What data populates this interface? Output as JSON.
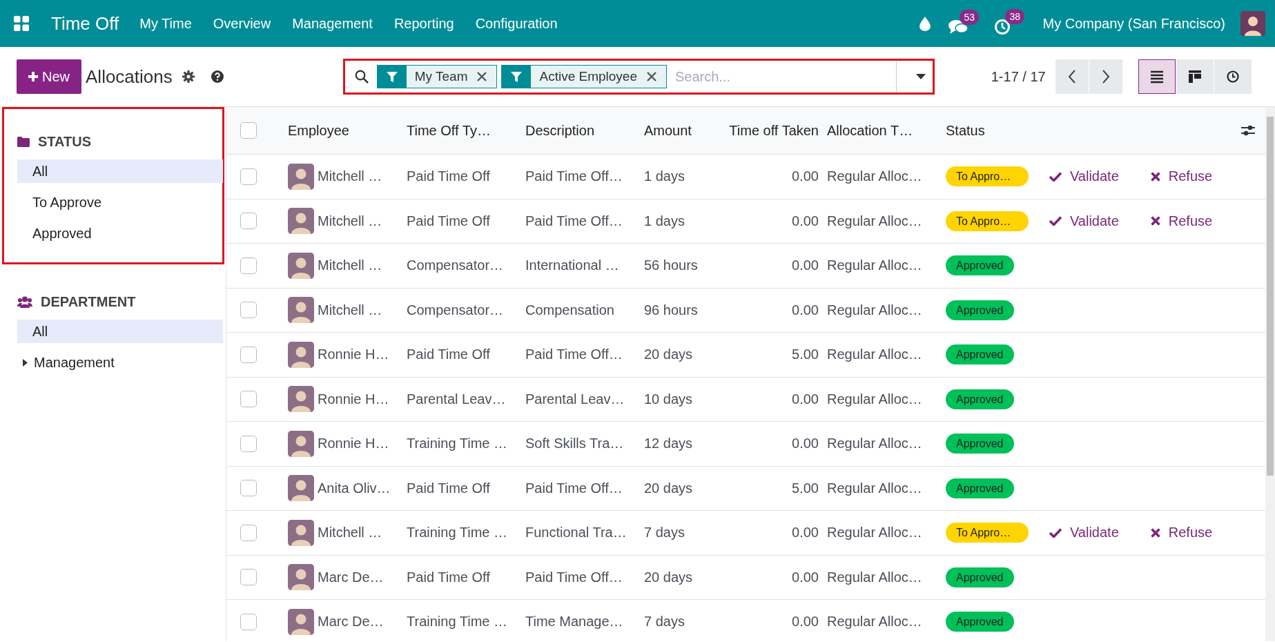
{
  "navbar": {
    "app_name": "Time Off",
    "menu": [
      "My Time",
      "Overview",
      "Management",
      "Reporting",
      "Configuration"
    ],
    "messages_count": "53",
    "activities_count": "38",
    "company": "My Company (San Francisco)"
  },
  "control_panel": {
    "new_button": "New",
    "title": "Allocations",
    "search": {
      "highlighted": true,
      "facets": [
        {
          "label": "My Team"
        },
        {
          "label": "Active Employee"
        }
      ],
      "placeholder": "Search..."
    },
    "pager": "1-17 / 17",
    "views": [
      {
        "kind": "list",
        "selected": true
      },
      {
        "kind": "kanban",
        "selected": false
      },
      {
        "kind": "activity",
        "selected": false
      }
    ]
  },
  "sidebar": {
    "sections": [
      {
        "kind": "status",
        "title": "STATUS",
        "highlighted": true,
        "items": [
          {
            "label": "All",
            "selected": true
          },
          {
            "label": "To Approve",
            "selected": false
          },
          {
            "label": "Approved",
            "selected": false
          }
        ]
      },
      {
        "kind": "department",
        "title": "DEPARTMENT",
        "highlighted": false,
        "items": [
          {
            "label": "All",
            "selected": true
          },
          {
            "label": "Management",
            "selected": false,
            "expanded": false
          }
        ]
      }
    ]
  },
  "table": {
    "select_all_checked": false,
    "columns": [
      "Employee",
      "Time Off Ty…",
      "Description",
      "Amount",
      "Time off Taken",
      "Allocation T…",
      "Status"
    ],
    "rows": [
      {
        "checked": false,
        "employee": "Mitchell …",
        "type": "Paid Time Off",
        "description": "Paid Time Off…",
        "amount": "1 days",
        "taken": "0.00",
        "allocation_type": "Regular Alloc…",
        "status": {
          "kind": "to_approve",
          "label": "To Appro…"
        },
        "actions": [
          {
            "kind": "validate",
            "label": "Validate"
          },
          {
            "kind": "refuse",
            "label": "Refuse"
          }
        ]
      },
      {
        "checked": false,
        "employee": "Mitchell …",
        "type": "Paid Time Off",
        "description": "Paid Time Off…",
        "amount": "1 days",
        "taken": "0.00",
        "allocation_type": "Regular Alloc…",
        "status": {
          "kind": "to_approve",
          "label": "To Appro…"
        },
        "actions": [
          {
            "kind": "validate",
            "label": "Validate"
          },
          {
            "kind": "refuse",
            "label": "Refuse"
          }
        ]
      },
      {
        "checked": false,
        "employee": "Mitchell …",
        "type": "Compensator…",
        "description": "International …",
        "amount": "56 hours",
        "taken": "0.00",
        "allocation_type": "Regular Alloc…",
        "status": {
          "kind": "approved",
          "label": "Approved"
        }
      },
      {
        "checked": false,
        "employee": "Mitchell …",
        "type": "Compensator…",
        "description": "Compensation",
        "amount": "96 hours",
        "taken": "0.00",
        "allocation_type": "Regular Alloc…",
        "status": {
          "kind": "approved",
          "label": "Approved"
        }
      },
      {
        "checked": false,
        "employee": "Ronnie H…",
        "type": "Paid Time Off",
        "description": "Paid Time Off…",
        "amount": "20 days",
        "taken": "5.00",
        "allocation_type": "Regular Alloc…",
        "status": {
          "kind": "approved",
          "label": "Approved"
        }
      },
      {
        "checked": false,
        "employee": "Ronnie H…",
        "type": "Parental Leav…",
        "description": "Parental Leav…",
        "amount": "10 days",
        "taken": "0.00",
        "allocation_type": "Regular Alloc…",
        "status": {
          "kind": "approved",
          "label": "Approved"
        }
      },
      {
        "checked": false,
        "employee": "Ronnie H…",
        "type": "Training Time …",
        "description": "Soft Skills Tra…",
        "amount": "12 days",
        "taken": "0.00",
        "allocation_type": "Regular Alloc…",
        "status": {
          "kind": "approved",
          "label": "Approved"
        }
      },
      {
        "checked": false,
        "employee": "Anita Oliv…",
        "type": "Paid Time Off",
        "description": "Paid Time Off…",
        "amount": "20 days",
        "taken": "5.00",
        "allocation_type": "Regular Alloc…",
        "status": {
          "kind": "approved",
          "label": "Approved"
        }
      },
      {
        "checked": false,
        "employee": "Mitchell …",
        "type": "Training Time …",
        "description": "Functional Tra…",
        "amount": "7 days",
        "taken": "0.00",
        "allocation_type": "Regular Alloc…",
        "status": {
          "kind": "to_approve",
          "label": "To Appro…"
        },
        "actions": [
          {
            "kind": "validate",
            "label": "Validate"
          },
          {
            "kind": "refuse",
            "label": "Refuse"
          }
        ]
      },
      {
        "checked": false,
        "employee": "Marc De…",
        "type": "Paid Time Off",
        "description": "Paid Time Off…",
        "amount": "20 days",
        "taken": "0.00",
        "allocation_type": "Regular Alloc…",
        "status": {
          "kind": "approved",
          "label": "Approved"
        }
      },
      {
        "checked": false,
        "employee": "Marc De…",
        "type": "Training Time …",
        "description": "Time Manage…",
        "amount": "7 days",
        "taken": "0.00",
        "allocation_type": "Regular Alloc…",
        "status": {
          "kind": "approved",
          "label": "Approved"
        }
      }
    ]
  }
}
